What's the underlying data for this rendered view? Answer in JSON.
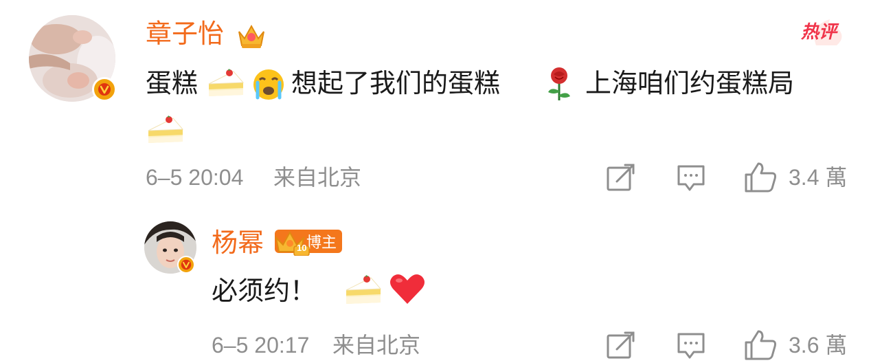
{
  "comments": [
    {
      "username": "章子怡",
      "text_part1": "蛋糕",
      "text_part2": "想起了我们的蛋糕",
      "text_part3": "上海咱们约蛋糕局",
      "time": "6–5 20:04",
      "location": "来自北京",
      "like_count": "3.4 萬",
      "hot_label": "热评"
    },
    {
      "username": "杨幂",
      "blogger_tag": "博主",
      "level": "10",
      "text": "必须约！",
      "time": "6–5 20:17",
      "location": "来自北京",
      "like_count": "3.6 萬"
    }
  ],
  "colors": {
    "username": "#f26a1b",
    "meta": "#8e8e8e",
    "hot": "#f0344a",
    "verified_badge": "#f2a20c"
  },
  "icons": [
    "crown-icon",
    "cake-emoji",
    "crying-emoji",
    "rose-emoji",
    "heart-emoji",
    "repost-icon",
    "comment-icon",
    "like-icon",
    "verified-icon"
  ]
}
